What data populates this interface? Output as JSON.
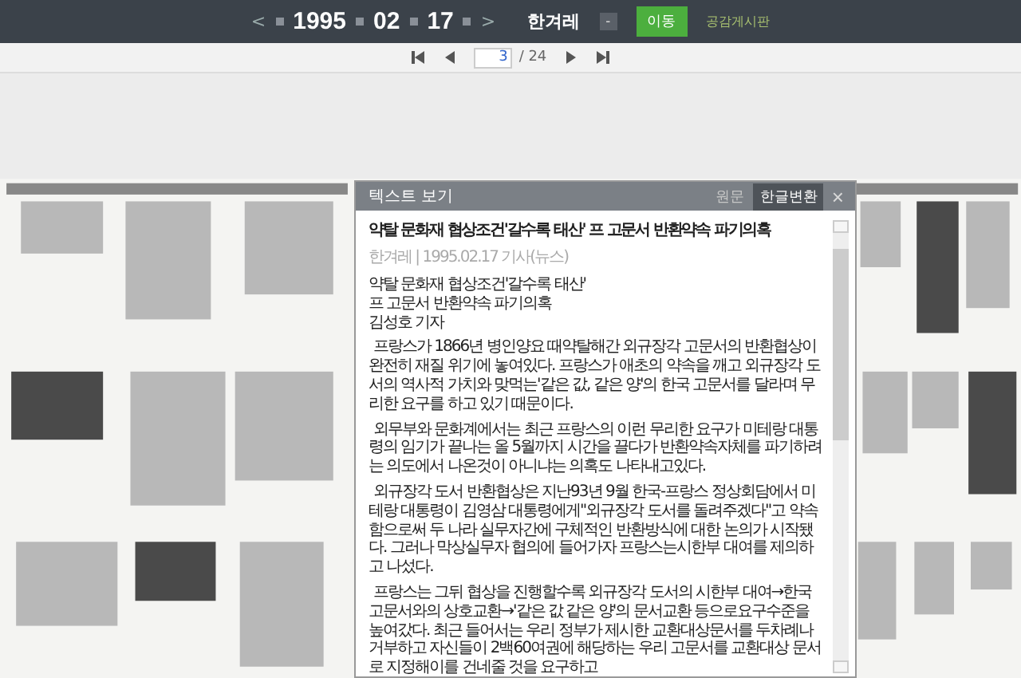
{
  "top_bar": {
    "prev": "<",
    "year": "1995",
    "month": "02",
    "day": "17",
    "next": ">",
    "paper": "한겨레",
    "dropdown": "-",
    "go_button": "이동",
    "link": "공감게시판"
  },
  "pager": {
    "page": "3",
    "total": "/ 24"
  },
  "text_view": {
    "title": "텍스트 보기",
    "tabs": [
      {
        "label": "원문",
        "selected": false
      },
      {
        "label": "한글변환",
        "selected": true
      }
    ],
    "close": "×",
    "headline": "약탈 문화재 협상조건'갈수록 태산' 프 고문서 반환약속 파기의혹",
    "meta": "한겨레 | 1995.02.17 기사(뉴스)",
    "lead": [
      "약탈 문화재 협상조건'갈수록 태산'",
      "프 고문서 반환약속 파기의혹",
      "김성호 기자"
    ],
    "paragraphs": [
      "프랑스가 1866년 병인양요 때약탈해간 외규장각 고문서의 반환협상이 완전히 재질 위기에 놓여있다. 프랑스가 애초의 약속을 깨고 외규장각 도서의 역사적 가치와 맞먹는'같은 값, 같은 양'의 한국 고문서를 달라며 무리한 요구를 하고 있기 때문이다.",
      "외무부와 문화계에서는 최근 프랑스의 이런 무리한 요구가 미테랑 대통령의 임기가 끝나는 올 5월까지 시간을 끌다가 반환약속자체를 파기하려는 의도에서 나온것이 아니냐는 의혹도 나타내고있다.",
      "외규장각 도서 반환협상은 지난93년 9월 한국-프랑스 정상회담에서 미테랑 대통령이 김영삼 대통령에게\"외규장각 도서를 돌려주겠다\"고 약속함으로써 두 나라 실무자간에 구체적인 반환방식에 대한 논의가 시작됐다. 그러나 막상실무자 협의에 들어가자 프랑스는시한부 대여를 제의하고 나섰다.",
      "프랑스는 그뒤 협상을 진행할수록 외규장각 도서의 시한부 대여→한국 고문서와의 상호교환→'같은 값 같은 양'의 문서교환 등으로요구수준을 높여갔다. 최근 들어서는 우리 정부가 제시한 교환대상문서를 두차례나 거부하고 자신들이 2백60여권에 해당하는 우리 고문서를 교환대상 문서로 지정해이를 건네줄 것을 요구하고"
    ]
  }
}
